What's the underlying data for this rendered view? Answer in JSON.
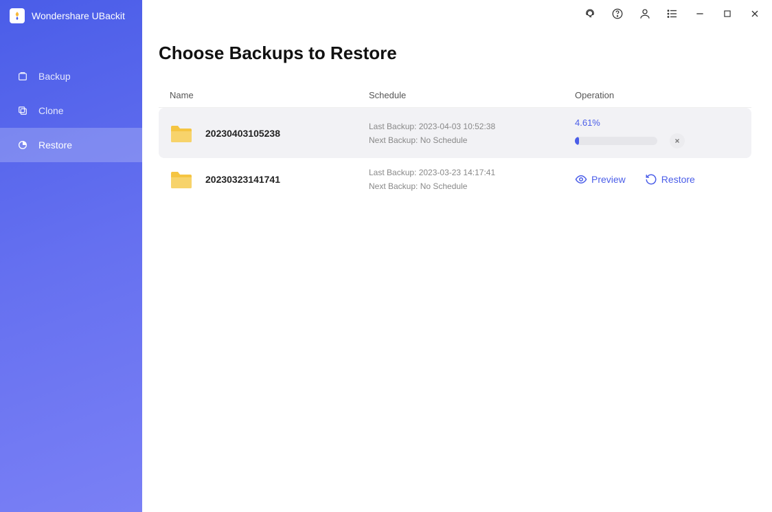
{
  "app": {
    "title": "Wondershare UBackit"
  },
  "sidebar": {
    "items": [
      {
        "label": "Backup"
      },
      {
        "label": "Clone"
      },
      {
        "label": "Restore"
      }
    ]
  },
  "page": {
    "title": "Choose Backups to Restore"
  },
  "columns": {
    "name": "Name",
    "schedule": "Schedule",
    "operation": "Operation"
  },
  "rows": [
    {
      "name": "20230403105238",
      "last": "Last Backup: 2023-04-03 10:52:38",
      "next": "Next Backup: No Schedule",
      "progress_text": "4.61%",
      "progress_pct": 4.61
    },
    {
      "name": "20230323141741",
      "last": "Last Backup: 2023-03-23 14:17:41",
      "next": "Next Backup: No Schedule"
    }
  ],
  "actions": {
    "preview": "Preview",
    "restore": "Restore"
  }
}
